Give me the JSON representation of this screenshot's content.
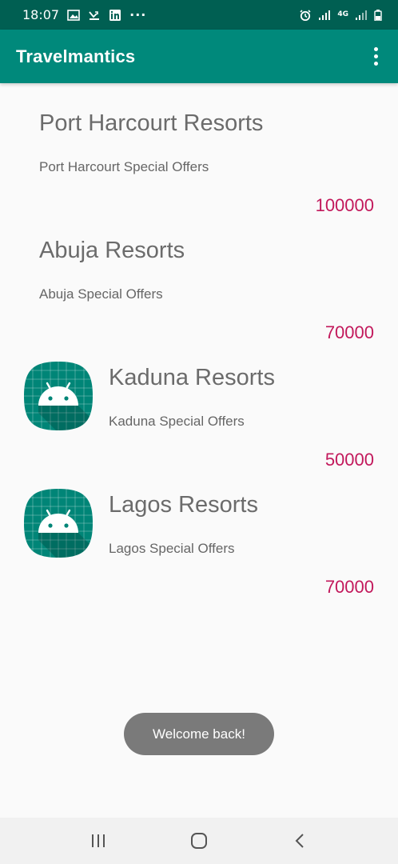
{
  "status_bar": {
    "time": "18:07",
    "more": "···",
    "network": "4G"
  },
  "app_bar": {
    "title": "Travelmantics",
    "overflow_icon": "more-vert-icon"
  },
  "deals": [
    {
      "title": "Port Harcourt Resorts",
      "description": "Port Harcourt Special Offers",
      "price": "100000",
      "has_image": false
    },
    {
      "title": "Abuja Resorts",
      "description": "Abuja Special Offers",
      "price": "70000",
      "has_image": false
    },
    {
      "title": "Kaduna Resorts",
      "description": "Kaduna Special Offers",
      "price": "50000",
      "has_image": true,
      "image_icon": "android-launcher-icon"
    },
    {
      "title": "Lagos Resorts",
      "description": "Lagos Special Offers",
      "price": "70000",
      "has_image": true,
      "image_icon": "android-launcher-icon"
    }
  ],
  "toast": {
    "message": "Welcome back!"
  },
  "nav_bar": {
    "recents_icon": "recents-icon",
    "home_icon": "home-icon",
    "back_icon": "back-icon"
  },
  "colors": {
    "status_bar": "#005f52",
    "app_bar": "#00897b",
    "price": "#c2185b",
    "toast": "#7a7a7a"
  }
}
